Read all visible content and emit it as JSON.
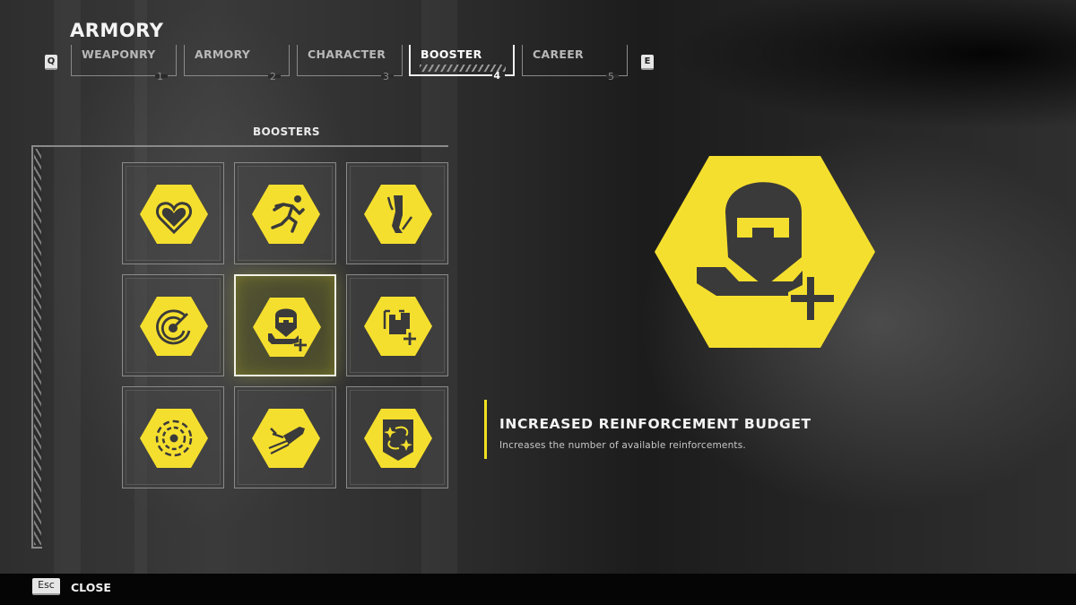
{
  "header": {
    "title": "ARMORY",
    "prev_key": "Q",
    "next_key": "E"
  },
  "tabs": [
    {
      "label": "WEAPONRY",
      "number": "1",
      "active": false
    },
    {
      "label": "ARMORY",
      "number": "2",
      "active": false
    },
    {
      "label": "CHARACTER",
      "number": "3",
      "active": false
    },
    {
      "label": "BOOSTER",
      "number": "4",
      "active": true
    },
    {
      "label": "CAREER",
      "number": "5",
      "active": false
    }
  ],
  "boosters": {
    "section_title": "BOOSTERS",
    "items": [
      {
        "icon": "heart-icon",
        "selected": false
      },
      {
        "icon": "running-man-icon",
        "selected": false
      },
      {
        "icon": "legs-icon",
        "selected": false
      },
      {
        "icon": "radar-target-icon",
        "selected": false
      },
      {
        "icon": "reinforcement-plus-icon",
        "selected": true
      },
      {
        "icon": "supply-box-plus-icon",
        "selected": false
      },
      {
        "icon": "dashed-circles-icon",
        "selected": false
      },
      {
        "icon": "hellpod-flight-icon",
        "selected": false
      },
      {
        "icon": "shield-sparkle-icon",
        "selected": false
      }
    ]
  },
  "detail": {
    "icon": "reinforcement-plus-icon",
    "title": "INCREASED REINFORCEMENT BUDGET",
    "description": "Increases the number of available reinforcements."
  },
  "footer": {
    "close_key": "Esc",
    "close_label": "CLOSE"
  },
  "colors": {
    "accent_yellow": "#f5df2e",
    "icon_dark": "#3a3a3a"
  }
}
